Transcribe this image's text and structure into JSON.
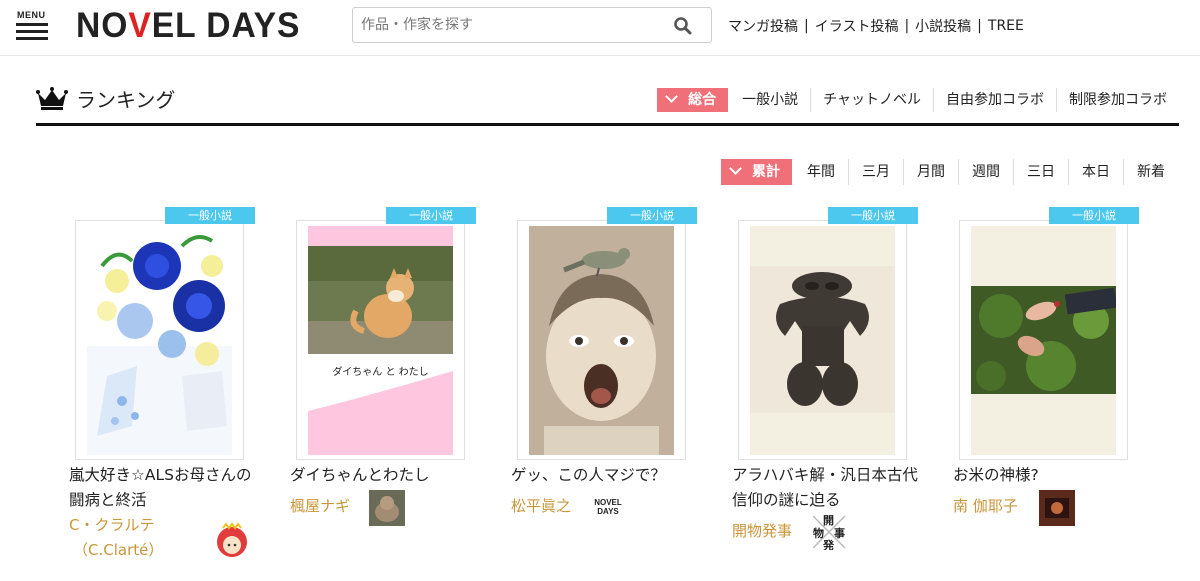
{
  "header": {
    "menu_label": "MENU",
    "logo_text": {
      "pre": "NO",
      "accent": "V",
      "post": "EL DAYS"
    },
    "search_placeholder": "作品・作家を探す",
    "links": [
      "マンガ投稿",
      "イラスト投稿",
      "小説投稿",
      "TREE"
    ],
    "separator": "|"
  },
  "ranking": {
    "title": "ランキング",
    "category_tabs": [
      {
        "label": "総合",
        "active": true
      },
      {
        "label": "一般小説",
        "active": false
      },
      {
        "label": "チャットノベル",
        "active": false
      },
      {
        "label": "自由参加コラボ",
        "active": false
      },
      {
        "label": "制限参加コラボ",
        "active": false
      }
    ],
    "period_tabs": [
      {
        "label": "累計",
        "active": true
      },
      {
        "label": "年間",
        "active": false
      },
      {
        "label": "三月",
        "active": false
      },
      {
        "label": "月間",
        "active": false
      },
      {
        "label": "週間",
        "active": false
      },
      {
        "label": "三日",
        "active": false
      },
      {
        "label": "本日",
        "active": false
      },
      {
        "label": "新着",
        "active": false
      }
    ]
  },
  "works": [
    {
      "genre": "一般小説",
      "title": "嵐大好き☆ALSお母さんの闘病と終活",
      "author_line1": "C・クラルテ",
      "author_line2": "（C.Clarté）",
      "cover_icon": "blue-rose-bouquet",
      "avatar_icon": "red-hood-girl"
    },
    {
      "genre": "一般小説",
      "title": "ダイちゃんとわたし",
      "author_line1": "楓屋ナギ",
      "author_line2": "",
      "cover_text": "ダイちゃん と わたし",
      "cover_icon": "cat-photo",
      "avatar_icon": "cat-photo"
    },
    {
      "genre": "一般小説",
      "title": "ゲッ、この人マジで？",
      "author_line1": "松平眞之",
      "author_line2": "",
      "cover_icon": "shouting-child-with-bird",
      "avatar_text_1": "NOVEL",
      "avatar_text_2": "DAYS"
    },
    {
      "genre": "一般小説",
      "title": "アラハバキ解・汎日本古代信仰の謎に迫る",
      "author_line1": "開物発事",
      "author_line2": "",
      "cover_icon": "dogu-figurine",
      "avatar_chars": [
        "開",
        "物",
        "事",
        "発"
      ]
    },
    {
      "genre": "一般小説",
      "title": "お米の神様?",
      "author_line1": "南 伽耶子",
      "author_line2": "",
      "cover_icon": "hands-in-foliage",
      "avatar_icon": "dark-photo"
    }
  ]
}
